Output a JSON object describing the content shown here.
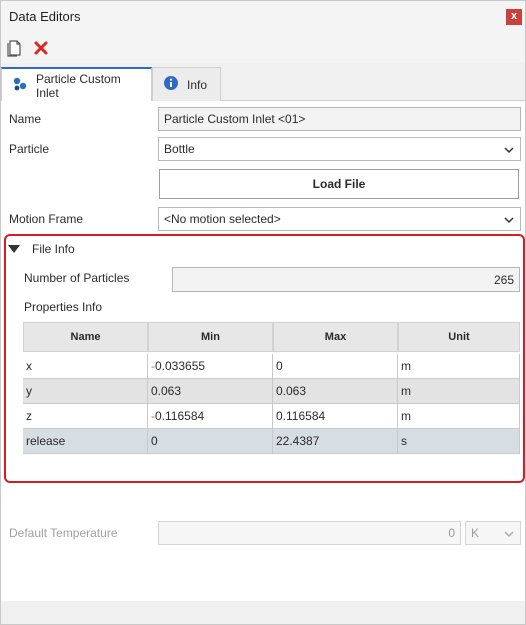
{
  "window": {
    "title": "Data Editors",
    "close_label": "x"
  },
  "toolbar": {
    "new_icon": "new-document-icon",
    "delete_icon": "delete-x-icon"
  },
  "tabs": [
    {
      "label": "Particle Custom Inlet",
      "icon": "particle-inlet-icon",
      "active": true
    },
    {
      "label": "Info",
      "icon": "info-icon",
      "active": false
    }
  ],
  "form": {
    "name_label": "Name",
    "name_value": "Particle Custom Inlet <01>",
    "particle_label": "Particle",
    "particle_value": "Bottle",
    "load_file_label": "Load File",
    "motion_label": "Motion Frame",
    "motion_value": "<No motion selected>"
  },
  "file_info": {
    "header": "File Info",
    "num_particles_label": "Number of Particles",
    "num_particles_value": "265",
    "properties_label": "Properties Info",
    "columns": [
      "Name",
      "Min",
      "Max",
      "Unit"
    ],
    "rows": [
      {
        "name": "x",
        "min_sign": "-",
        "min": "0.033655",
        "max": "0",
        "unit": "m"
      },
      {
        "name": "y",
        "min_sign": "",
        "min": "0.063",
        "max": "0.063",
        "unit": "m"
      },
      {
        "name": "z",
        "min_sign": "-",
        "min": "0.116584",
        "max": "0.116584",
        "unit": "m"
      },
      {
        "name": "release",
        "min_sign": "",
        "min": "0",
        "max": "22.4387",
        "unit": "s"
      }
    ]
  },
  "temperature": {
    "label": "Default Temperature",
    "value": "0",
    "unit": "K"
  },
  "colors": {
    "accent": "#2d6cc0",
    "highlight_border": "#d41c24",
    "close": "#c9413d"
  }
}
